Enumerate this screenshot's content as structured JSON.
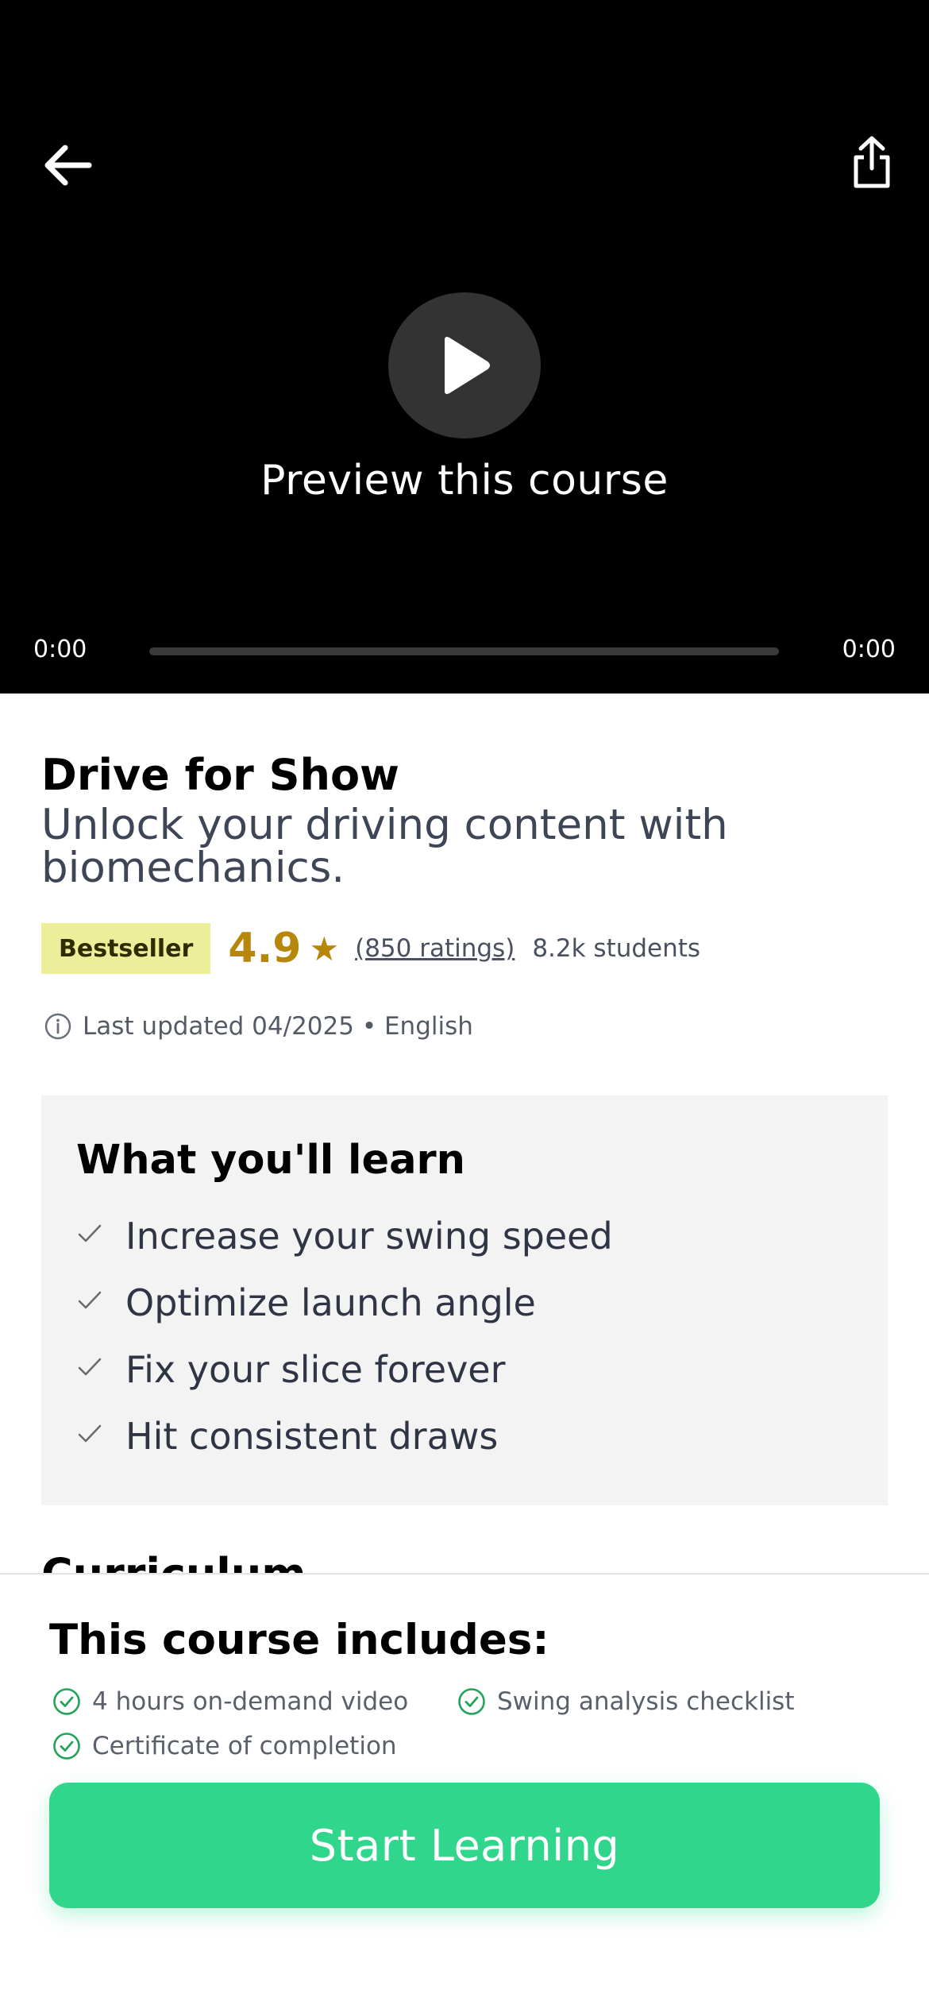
{
  "player": {
    "preview_label": "Preview this course",
    "time_current": "0:00",
    "time_total": "0:00",
    "progress": 0
  },
  "course": {
    "title": "Drive for Show",
    "subtitle": "Unlock your driving content with biomechanics.",
    "badge": "Bestseller",
    "rating": "4.9",
    "star": "★",
    "ratings_count": "(850 ratings)",
    "students": "8.2k students",
    "updated": "Last updated 04/2025 • English"
  },
  "learn": {
    "title": "What you'll learn",
    "items": [
      "Increase your swing speed",
      "Optimize launch angle",
      "Fix your slice forever",
      "Hit consistent draws"
    ]
  },
  "peek_heading": "Curriculum",
  "includes": {
    "title": "This course includes:",
    "features": [
      "4 hours on-demand video",
      "Swing analysis checklist",
      "Certificate of completion"
    ]
  },
  "cta": {
    "label": "Start Learning"
  },
  "colors": {
    "accent": "#2fd68b",
    "badge_bg": "#ecee99",
    "rating": "#b8860b",
    "video_bg": "#000000"
  },
  "icons": [
    "back-arrow-icon",
    "share-icon",
    "play-icon",
    "info-icon",
    "check-icon",
    "check-circle-icon"
  ]
}
